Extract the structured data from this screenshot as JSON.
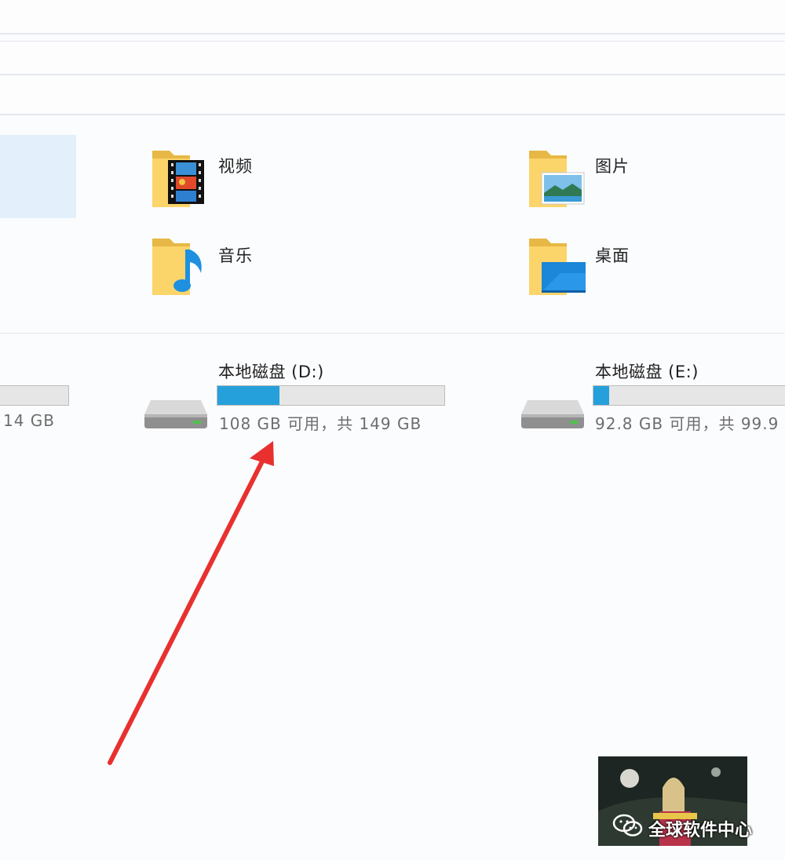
{
  "folders": {
    "videos": {
      "label": "视频"
    },
    "pictures": {
      "label": "图片"
    },
    "music": {
      "label": "音乐"
    },
    "desktop": {
      "label": "桌面"
    }
  },
  "drives": {
    "c_partial": {
      "stat": "14 GB",
      "used_percent": 30
    },
    "d": {
      "name": "本地磁盘 (D:)",
      "stat": "108 GB 可用，共 149 GB",
      "used_percent": 27.5
    },
    "e": {
      "name": "本地磁盘 (E:)",
      "stat": "92.8 GB 可用，共 99.9",
      "used_percent": 7
    }
  },
  "watermark": {
    "text": "全球软件中心"
  },
  "colors": {
    "arrow": "#e8312f",
    "bar_fill": "#26a0da",
    "selection": "#e3f0fb"
  }
}
